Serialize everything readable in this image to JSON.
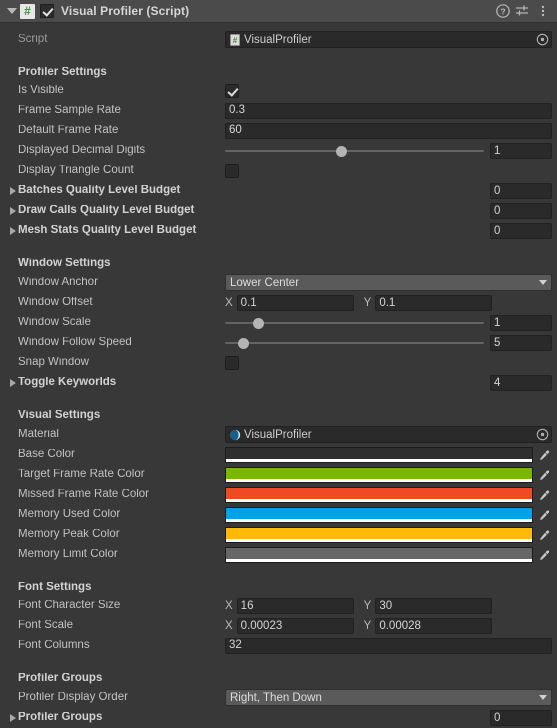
{
  "header": {
    "title": "Visual Profiler (Script)",
    "script_icon": "csharp-script-icon",
    "enabled": true,
    "help_icon": "help-icon",
    "preset_icon": "preset-sliders-icon",
    "menu_icon": "kebab-menu-icon"
  },
  "script_row": {
    "label": "Script",
    "value": "VisualProfiler"
  },
  "profiler_settings": {
    "title": "Profiler Settings",
    "is_visible": {
      "label": "Is Visible",
      "checked": true
    },
    "frame_sample_rate": {
      "label": "Frame Sample Rate",
      "value": "0.3"
    },
    "default_frame_rate": {
      "label": "Default Frame Rate",
      "value": "60"
    },
    "displayed_decimal_digits": {
      "label": "Displayed Decimal Digits",
      "value": "1",
      "slider_pct": 45
    },
    "display_triangle_count": {
      "label": "Display Triangle Count",
      "checked": false
    },
    "batches_budget": {
      "label": "Batches Quality Level Budget",
      "value": "0"
    },
    "draw_calls_budget": {
      "label": "Draw Calls Quality Level Budget",
      "value": "0"
    },
    "mesh_stats_budget": {
      "label": "Mesh Stats Quality Level Budget",
      "value": "0"
    }
  },
  "window_settings": {
    "title": "Window Settings",
    "window_anchor": {
      "label": "Window Anchor",
      "value": "Lower Center"
    },
    "window_offset": {
      "label": "Window Offset",
      "x_axis": "X",
      "x": "0.1",
      "y_axis": "Y",
      "y": "0.1"
    },
    "window_scale": {
      "label": "Window Scale",
      "value": "1",
      "slider_pct": 13
    },
    "window_follow_speed": {
      "label": "Window Follow Speed",
      "value": "5",
      "slider_pct": 7
    },
    "snap_window": {
      "label": "Snap Window",
      "checked": false
    },
    "toggle_keyworlds": {
      "label": "Toggle Keyworlds",
      "value": "4"
    }
  },
  "visual_settings": {
    "title": "Visual Settings",
    "material": {
      "label": "Material",
      "value": "VisualProfiler"
    },
    "base_color": {
      "label": "Base Color",
      "color": "#2e2e2e",
      "alpha_color": "#ffffff"
    },
    "target_frame_rate_color": {
      "label": "Target Frame Rate Color",
      "color": "#7ab800",
      "alpha_color": "#ffffff"
    },
    "missed_frame_rate_color": {
      "label": "Missed Frame Rate Color",
      "color": "#f04a24",
      "alpha_color": "#ffffff"
    },
    "memory_used_color": {
      "label": "Memory Used Color",
      "color": "#00a2ea",
      "alpha_color": "#ffffff"
    },
    "memory_peak_color": {
      "label": "Memory Peak Color",
      "color": "#ffba08",
      "alpha_color": "#ffffff"
    },
    "memory_limit_color": {
      "label": "Memory Limit Color",
      "color": "#666666",
      "alpha_color": "#ffffff"
    }
  },
  "font_settings": {
    "title": "Font Settings",
    "font_character_size": {
      "label": "Font Character Size",
      "x_axis": "X",
      "x": "16",
      "y_axis": "Y",
      "y": "30"
    },
    "font_scale": {
      "label": "Font Scale",
      "x_axis": "X",
      "x": "0.00023",
      "y_axis": "Y",
      "y": "0.00028"
    },
    "font_columns": {
      "label": "Font Columns",
      "value": "32"
    }
  },
  "profiler_groups": {
    "title": "Profiler Groups",
    "display_order": {
      "label": "Profiler Display Order",
      "value": "Right, Then Down"
    },
    "groups_list": {
      "label": "Profiler Groups",
      "value": "0"
    }
  }
}
